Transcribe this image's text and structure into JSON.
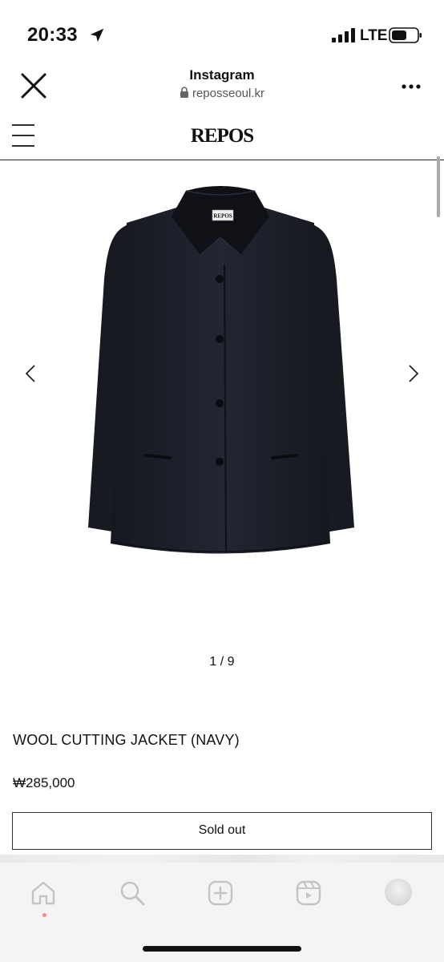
{
  "status_bar": {
    "time": "20:33",
    "network": "LTE",
    "location_icon": "location-arrow-icon",
    "signal_icon": "cellular-signal-icon",
    "battery_icon": "battery-icon"
  },
  "browser_header": {
    "title": "Instagram",
    "url": "reposseoul.kr",
    "close_icon": "close-icon",
    "lock_icon": "lock-icon",
    "more_icon": "more-horizontal-icon"
  },
  "site": {
    "logo": "REPOS",
    "menu_icon": "hamburger-menu-icon"
  },
  "carousel": {
    "counter": "1 / 9",
    "label_text": "REPOS",
    "prev_icon": "chevron-left-icon",
    "next_icon": "chevron-right-icon"
  },
  "product": {
    "name": "WOOL CUTTING JACKET (NAVY)",
    "price": "₩285,000",
    "button_label": "Sold out"
  },
  "tab_bar": {
    "items": [
      {
        "icon": "home-icon",
        "active": true
      },
      {
        "icon": "search-icon",
        "active": false
      },
      {
        "icon": "create-plus-icon",
        "active": false
      },
      {
        "icon": "reels-icon",
        "active": false
      },
      {
        "icon": "profile-avatar",
        "active": false
      }
    ]
  },
  "colors": {
    "text": "#111111",
    "jacket": "#1c1f27",
    "tab_bar_bg": "#f4f4f4",
    "tab_icon": "#c4c4c4",
    "home_dot": "#f48a8a"
  }
}
